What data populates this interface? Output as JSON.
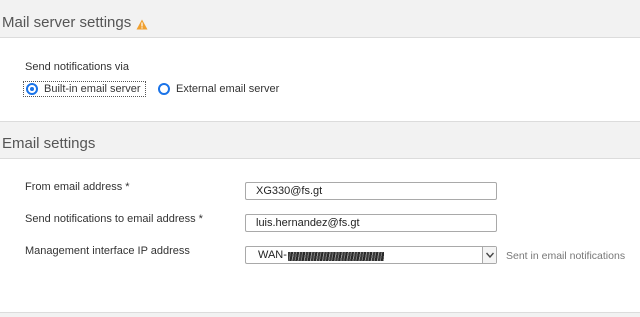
{
  "mail_server": {
    "title": "Mail server settings",
    "send_via_label": "Send notifications via",
    "options": [
      {
        "label": "Built-in email server",
        "selected": true
      },
      {
        "label": "External email server",
        "selected": false
      }
    ]
  },
  "email_settings": {
    "title": "Email settings",
    "from_label": "From email address *",
    "from_value": "XG330@fs.gt",
    "to_label": "Send notifications to email address *",
    "to_value": "luis.hernandez@fs.gt",
    "mgmt_label": "Management interface IP address",
    "mgmt_value": "WAN-",
    "mgmt_hint": "Sent in email notifications"
  },
  "colors": {
    "accent": "#1a73e8",
    "warning": "#f0a030"
  },
  "icons": {
    "warning": "warning-triangle-icon",
    "dropdown": "chevron-down-icon"
  }
}
